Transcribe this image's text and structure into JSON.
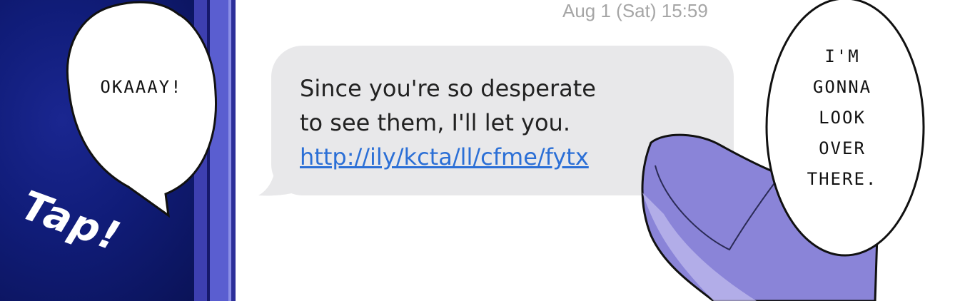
{
  "message": {
    "timestamp": "Aug 1 (Sat) 15:59",
    "line1": "Since you're so desperate",
    "line2": "to see them, I'll let you.",
    "link": "http://ily/kcta/ll/cfme/fytx"
  },
  "speech_left": "OKAAAY!",
  "speech_right": {
    "lines": [
      "I'M",
      "GONNA",
      "LOOK",
      "OVER",
      "THERE."
    ]
  },
  "sfx": "Tap!",
  "colors": {
    "panel_bg": "#101c78",
    "bubble_bg": "#e8e8ea",
    "link": "#2b6fd6",
    "finger": "#8a84d8"
  }
}
